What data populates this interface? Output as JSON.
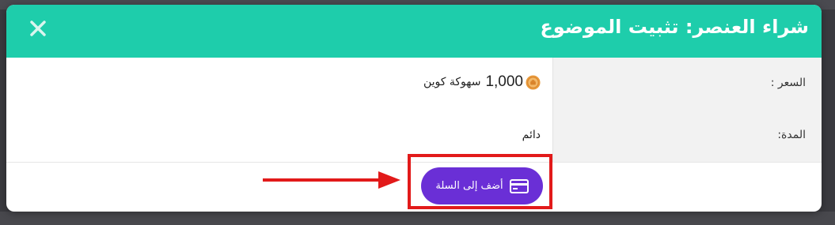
{
  "modal": {
    "title": "شراء العنصر: تثبيت الموضوع",
    "close_icon": "close-icon"
  },
  "details": {
    "price_label": "السعر :",
    "price_amount": "1,000",
    "price_currency": "سهوكة كوين",
    "coin_icon": "coin-icon",
    "duration_label": "المدة:",
    "duration_value": "دائم"
  },
  "footer": {
    "add_to_cart_label": "أضف إلى السلة",
    "card_icon": "credit-card-icon"
  },
  "annotation": {
    "highlight_color": "#e21a1a",
    "arrow_icon": "arrow-right-icon"
  },
  "colors": {
    "header": "#1ecdab",
    "button": "#6a2fd6"
  }
}
